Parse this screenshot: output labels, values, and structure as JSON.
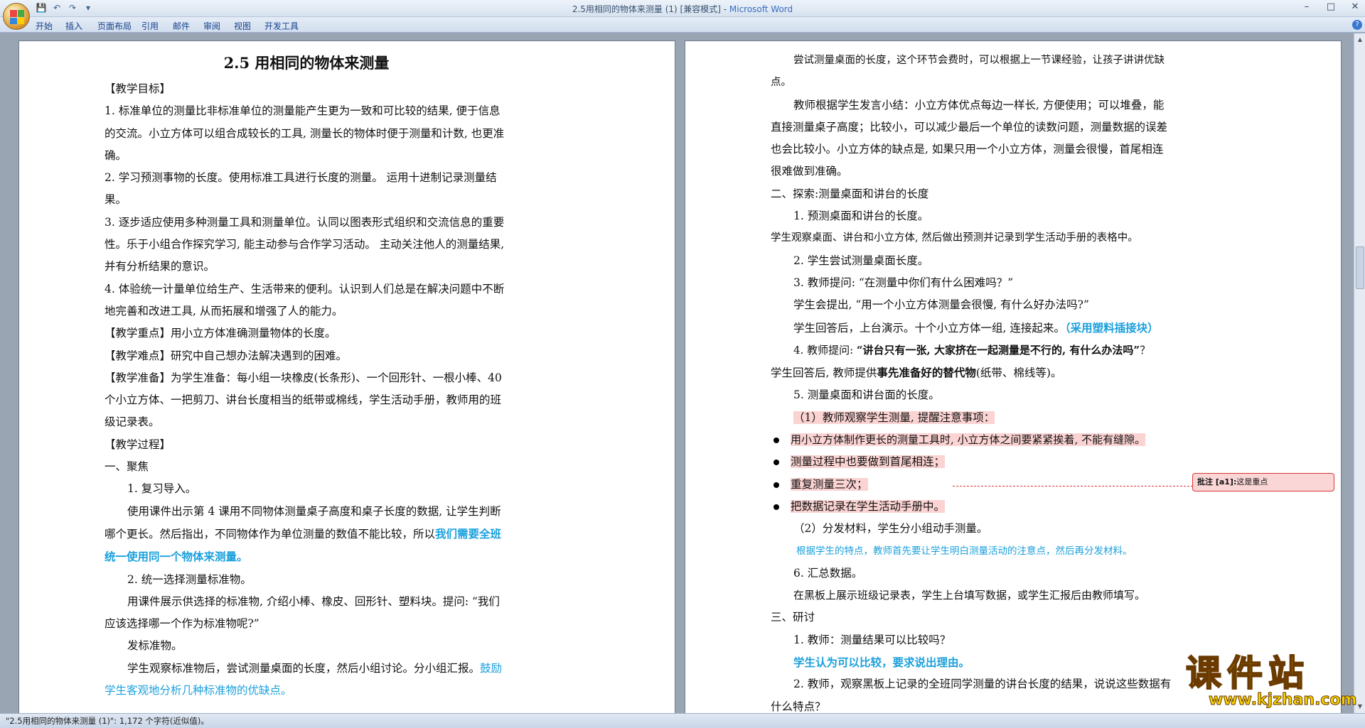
{
  "window": {
    "title_doc": "2.5用相同的物体来测量 (1) [兼容模式] - ",
    "title_app": "Microsoft Word",
    "controls": [
      "–",
      "□",
      "✕"
    ]
  },
  "qat": {
    "save_icon": "save-icon",
    "undo_icon": "undo-icon",
    "redo_icon": "redo-icon",
    "customize_icon": "dropdown-icon"
  },
  "ribbon": {
    "tabs": [
      "开始",
      "插入",
      "页面布局",
      "引用",
      "邮件",
      "审阅",
      "视图",
      "开发工具"
    ],
    "help_label": "?"
  },
  "left_page": {
    "title": "2.5 用相同的物体来测量",
    "paragraphs": [
      "【教学目标】",
      "1. 标准单位的测量比非标准单位的测量能产生更为一致和可比较的结果, 便于信息的交流。小立方体可以组合成较长的工具, 测量长的物体时便于测量和计数, 也更准确。",
      "2. 学习预测事物的长度。使用标准工具进行长度的测量。 运用十进制记录测量结果。",
      "3. 逐步适应使用多种测量工具和测量单位。认同以图表形式组织和交流信息的重要性。乐于小组合作探究学习, 能主动参与合作学习活动。 主动关注他人的测量结果, 并有分析结果的意识。",
      "4. 体验统一计量单位给生产、生活带来的便利。认识到人们总是在解决问题中不断地完善和改进工具, 从而拓展和增强了人的能力。",
      "【教学重点】用小立方体准确测量物体的长度。",
      "【教学难点】研究中自己想办法解决遇到的困难。",
      "【教学准备】为学生准备：每小组一块橡皮(长条形)、一个回形针、一根小棒、40 个小立方体、一把剪刀、讲台长度相当的纸带或棉线，学生活动手册，教师用的班级记录表。",
      "【教学过程】",
      "一、聚焦",
      "1. 复习导入。",
      "使用课件出示第 4 课用不同物体测量桌子高度和桌子长度的数据, 让学生判断哪个更长。然后指出，不同物体作为单位测量的数值不能比较，所以",
      "我们需要全班统一使用同一个物体来测量。",
      "2. 统一选择测量标准物。",
      "用课件展示供选择的标准物, 介绍小棒、橡皮、回形针、塑料块。提问: “我们应该选择哪一个作为标准物呢?”",
      "发标准物。",
      "学生观察标准物后，尝试测量桌面的长度，然后小组讨论。分小组汇报。",
      "鼓励学生客观地分析几种标准物的优缺点。"
    ]
  },
  "right_page": {
    "paragraphs": [
      "尝试测量桌面的长度，这个环节会费时，可以根据上一节课经验，让孩子讲讲优缺点。",
      "教师根据学生发言小结：小立方体优点每边一样长, 方便使用；可以堆叠，能直接测量桌子高度；比较小，可以减少最后一个单位的读数问题，测量数据的误差也会比较小。小立方体的缺点是, 如果只用一个小立方体，测量会很慢，首尾相连很难做到准确。",
      "二、探索:测量桌面和讲台的长度",
      "1. 预测桌面和讲台的长度。",
      "学生观察桌面、讲台和小立方体, 然后做出预测并记录到学生活动手册的表格中。",
      "2. 学生尝试测量桌面长度。",
      "3. 教师提问: “在测量中你们有什么困难吗？”",
      "学生会提出, “用一个小立方体测量会很慢, 有什么好办法吗?”",
      "学生回答后，上台演示。十个小立方体一组, 连接起来。",
      "（采用塑料插接块）",
      "4. 教师提问: ",
      "“讲台只有一张, 大家挤在一起测量是不行的, 有什么办法吗”",
      "？",
      "学生回答后, 教师提供",
      "事先准备好的替代物",
      "(纸带、棉线等)。",
      "5. 测量桌面和讲台面的长度。",
      "（1）教师观察学生测量, 提醒注意事项：",
      "用小立方体制作更长的测量工具时, 小立方体之间要紧紧挨着, 不能有缝隙。",
      "测量过程中也要做到首尾相连；",
      "重复测量三次；",
      "把数据记录在学生活动手册中。",
      "（2）分发材料，学生分小组动手测量。",
      "根据学生的特点，教师首先要让学生明白测量活动的注意点，然后再分发材料。",
      "6. 汇总数据。",
      "在黑板上展示班级记录表，学生上台填写数据，或学生汇报后由教师填写。",
      "三、研讨",
      "1. 教师：测量结果可以比较吗？",
      "学生认为可以比较，要求说出理由。",
      "2. 教师，观察黑板上记录的全班同学测量的讲台长度的结果，说说这些数据有什么特点？"
    ]
  },
  "comment": {
    "label": "批注 [a1]:",
    "text": "这是重点"
  },
  "status": {
    "text": "\"2.5用相同的物体来测量 (1)\": 1,172 个字符(近似值)。"
  },
  "watermark": {
    "main": "课件站",
    "url": "www.kjzhan.com"
  },
  "colors": {
    "accent_blue": "#1aa0dc",
    "highlight_pink": "#fbd3d3",
    "comment_red": "#dd3333"
  }
}
